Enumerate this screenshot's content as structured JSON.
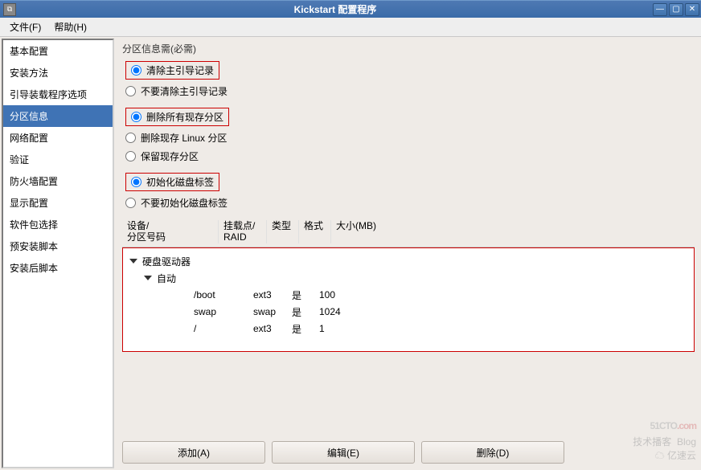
{
  "window": {
    "title": "Kickstart 配置程序"
  },
  "menu": {
    "file": "文件(F)",
    "help": "帮助(H)"
  },
  "sidebar": {
    "items": [
      "基本配置",
      "安装方法",
      "引导装载程序选项",
      "分区信息",
      "网络配置",
      "验证",
      "防火墙配置",
      "显示配置",
      "软件包选择",
      "预安装脚本",
      "安装后脚本"
    ],
    "selected": 3
  },
  "main": {
    "group_label": "分区信息需(必需)",
    "mbr": {
      "opt0": "清除主引导记录",
      "opt1": "不要清除主引导记录"
    },
    "remove": {
      "opt0": "删除所有现存分区",
      "opt1": "删除现存 Linux 分区",
      "opt2": "保留现存分区"
    },
    "initlabel": {
      "opt0": "初始化磁盘标签",
      "opt1": "不要初始化磁盘标签"
    },
    "cols": {
      "c1a": "设备/",
      "c1b": "分区号码",
      "c2a": "挂载点/",
      "c2b": "RAID",
      "c3": "类型",
      "c4": "格式",
      "c5": "大小(MB)"
    },
    "tree": {
      "root": "硬盘驱动器",
      "auto": "自动",
      "rows": [
        {
          "mount": "/boot",
          "type": "ext3",
          "fmt": "是",
          "size": "100"
        },
        {
          "mount": "swap",
          "type": "swap",
          "fmt": "是",
          "size": "1024"
        },
        {
          "mount": "/",
          "type": "ext3",
          "fmt": "是",
          "size": "1"
        }
      ]
    },
    "buttons": {
      "add": "添加(A)",
      "edit": "编辑(E)",
      "delete": "删除(D)"
    }
  },
  "watermark": {
    "line1": "51CTO.com",
    "line2a": "技术播客",
    "line2b": "Blog",
    "line3": "亿速云"
  }
}
